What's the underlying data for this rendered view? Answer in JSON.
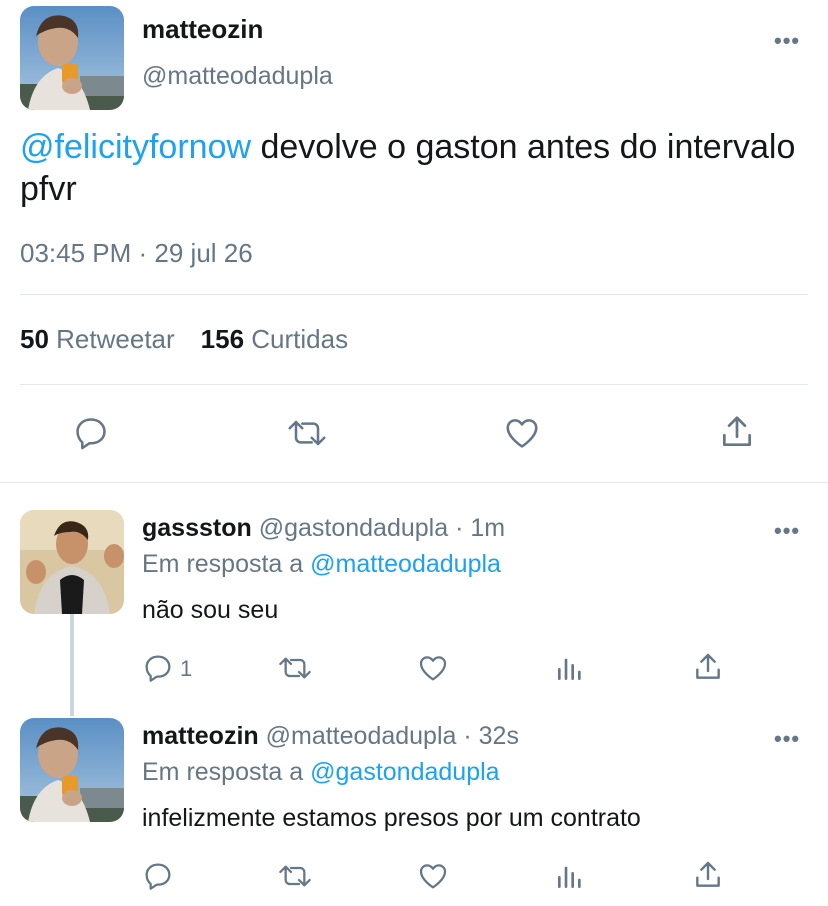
{
  "main_tweet": {
    "name": "matteozin",
    "handle": "@matteodadupla",
    "mention": "@felicityfornow",
    "text": " devolve o gaston antes do intervalo pfvr",
    "timestamp": "03:45 PM · 29 jul 26",
    "retweets_count": "50",
    "retweets_label": "Retweetar",
    "likes_count": "156",
    "likes_label": "Curtidas",
    "more_label": "•••"
  },
  "replies": [
    {
      "name": "gassston",
      "handle_time": " @gastondadupla · 1m",
      "reply_to_label": "Em resposta a ",
      "reply_to_handle": "@matteodadupla",
      "text": "não sou seu",
      "reply_count": "1",
      "more_label": "•••"
    },
    {
      "name": "matteozin",
      "handle_time": " @matteodadupla · 32s",
      "reply_to_label": "Em resposta a ",
      "reply_to_handle": "@gastondadupla",
      "text": " infelizmente estamos presos por um contrato",
      "reply_count": "",
      "more_label": "•••"
    }
  ],
  "colors": {
    "accent": "#1da1f2",
    "secondary_text": "#657786",
    "primary_text": "#14171a",
    "divider": "#e1e8ed"
  },
  "icons": [
    "reply-icon",
    "retweet-icon",
    "like-icon",
    "share-icon",
    "analytics-icon",
    "more-icon"
  ]
}
